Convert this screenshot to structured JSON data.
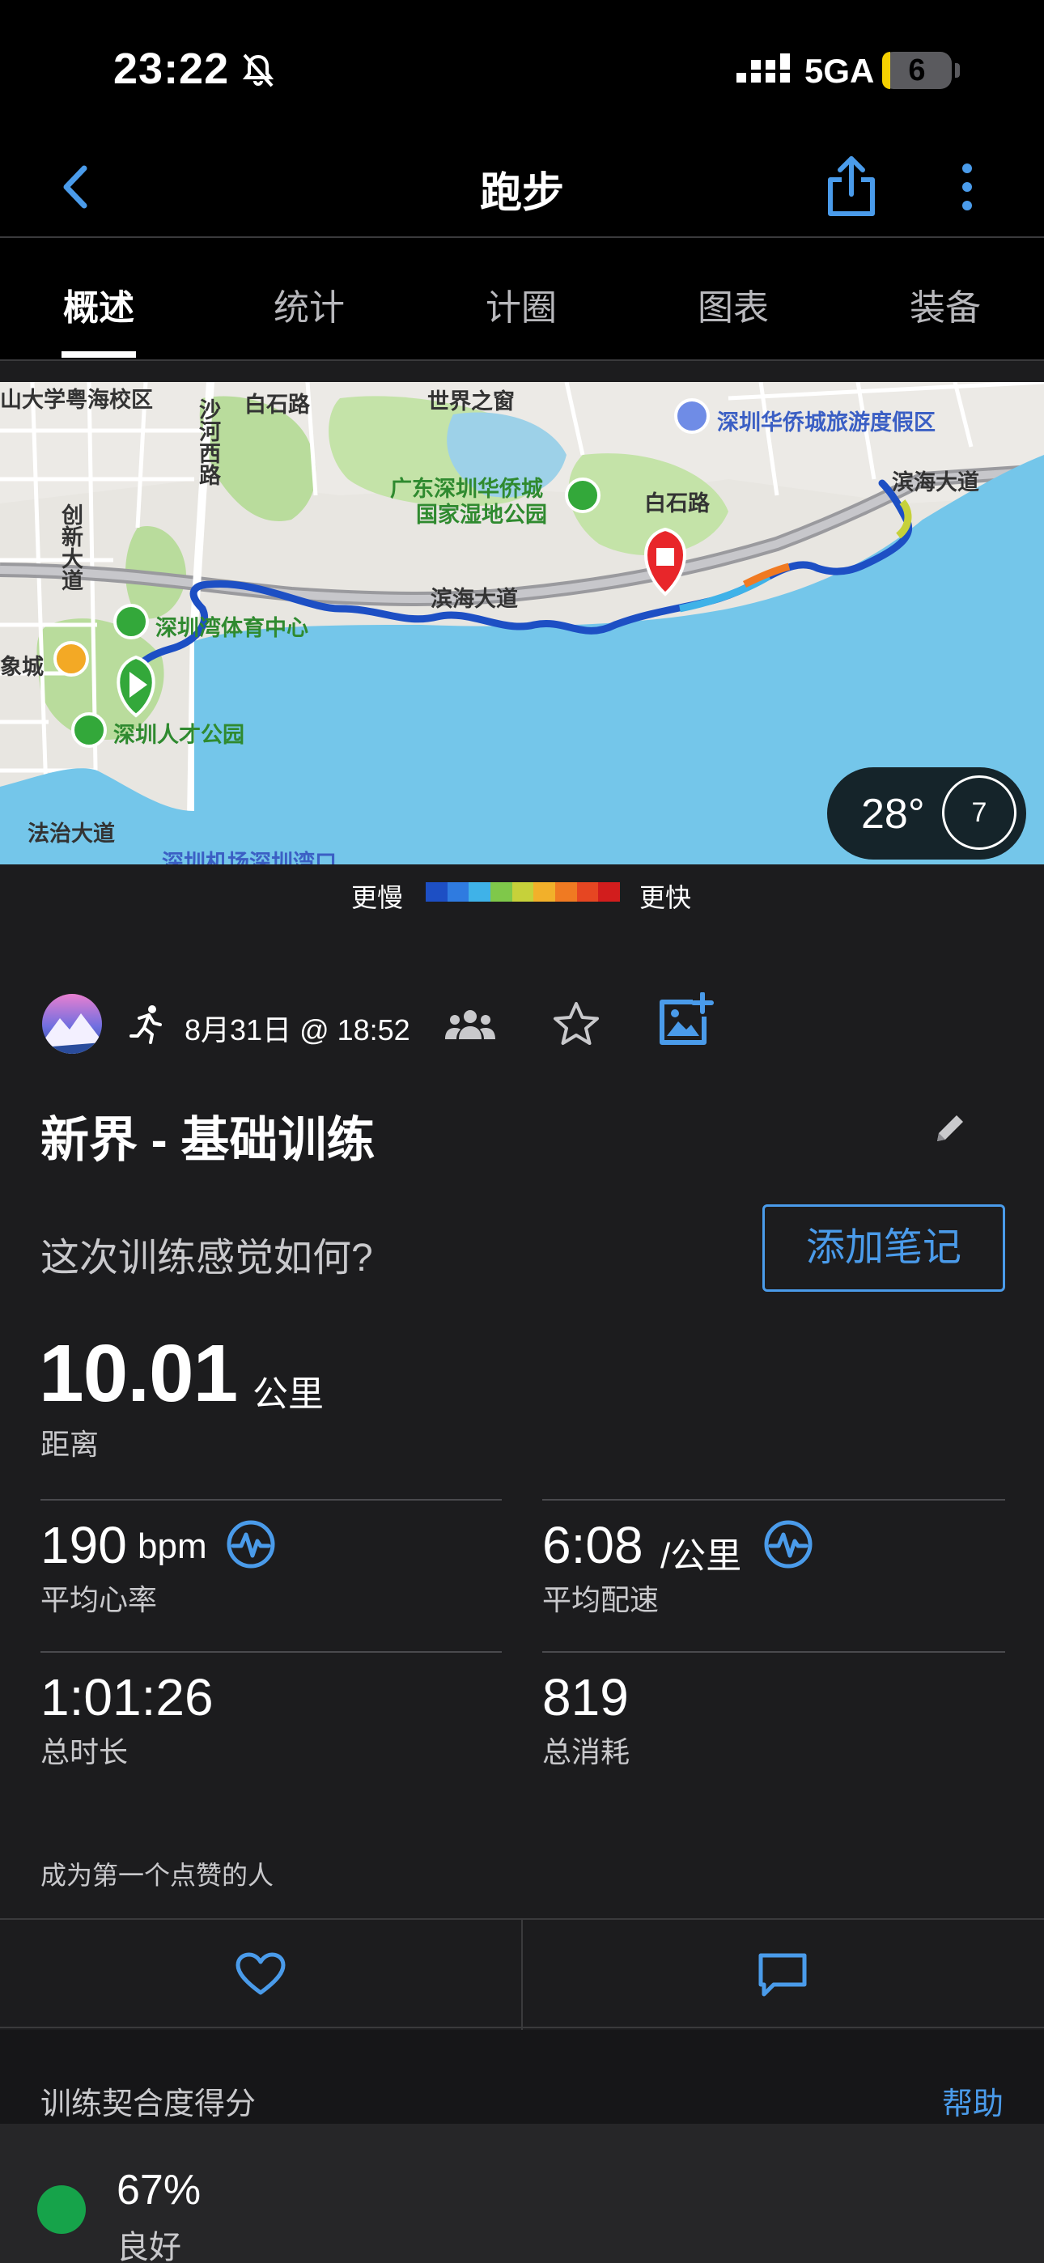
{
  "status_bar": {
    "time": "23:22",
    "network": "5GA",
    "battery": "6"
  },
  "nav": {
    "title": "跑步"
  },
  "tabs": [
    {
      "label": "概述",
      "active": true
    },
    {
      "label": "统计",
      "active": false
    },
    {
      "label": "计圈",
      "active": false
    },
    {
      "label": "图表",
      "active": false
    },
    {
      "label": "装备",
      "active": false
    }
  ],
  "map": {
    "labels": {
      "university": "山大学粤海校区",
      "baishi_road_1": "白石路",
      "window_of_world": "世界之窗",
      "octc_resort": "深圳华侨城旅游度假区",
      "wetland_park": "广东深圳华侨城",
      "wetland_park_2": "国家湿地公园",
      "baishi_road_2": "白石路",
      "binhai_ave_1": "滨海大道",
      "binhai_ave_2": "滨海大道",
      "sports_center": "深圳湾体育中心",
      "talent_park": "深圳人才公园",
      "innovation_ave": "创新大道",
      "shahe_west": "沙河西路",
      "xiangcheng": "象城",
      "legal_road": "法治大道",
      "airport_port": "深圳机场深圳湾口"
    },
    "weather": {
      "temperature": "28°",
      "wind": "7"
    }
  },
  "legend": {
    "slower": "更慢",
    "faster": "更快",
    "colors": [
      "#1d4fc4",
      "#2f7be0",
      "#3fb2e8",
      "#7fc84a",
      "#c6d13a",
      "#f2b02a",
      "#f07a22",
      "#e64622",
      "#d21d1d"
    ]
  },
  "activity": {
    "date": "8月31日 @ 18:52",
    "title": "新界 - 基础训练",
    "feel_question": "这次训练感觉如何?",
    "add_note": "添加笔记",
    "distance": {
      "value": "10.01",
      "unit": "公里",
      "label": "距离"
    },
    "stats": {
      "heart_rate": {
        "value": "190",
        "unit": "bpm",
        "label": "平均心率"
      },
      "pace": {
        "value": "6:08",
        "unit": "/公里",
        "label": "平均配速"
      },
      "duration": {
        "value": "1:01:26",
        "label": "总时长"
      },
      "calories": {
        "value": "819",
        "label": "总消耗"
      }
    },
    "like_prompt": "成为第一个点赞的人"
  },
  "score": {
    "title": "训练契合度得分",
    "help": "帮助",
    "value": "67%",
    "label": "良好",
    "color": "#16a34a"
  },
  "colors": {
    "accent": "#4a9bea",
    "background": "#1c1c1e"
  }
}
